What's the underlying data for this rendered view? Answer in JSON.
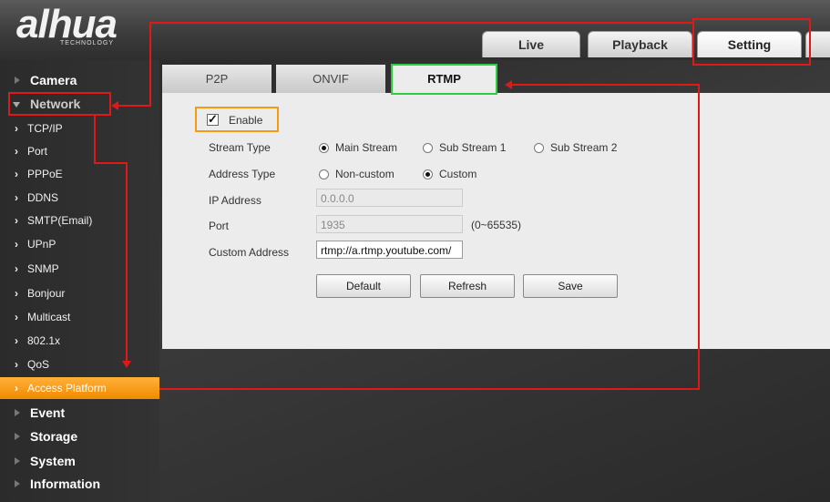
{
  "brand": {
    "name": "alhua",
    "tagline": "TECHNOLOGY"
  },
  "top_tabs": [
    "Live",
    "Playback",
    "Setting"
  ],
  "sidebar": {
    "camera": "Camera",
    "network": "Network",
    "network_items": [
      "TCP/IP",
      "Port",
      "PPPoE",
      "DDNS",
      "SMTP(Email)",
      "UPnP",
      "SNMP",
      "Bonjour",
      "Multicast",
      "802.1x",
      "QoS",
      "Access Platform"
    ],
    "event": "Event",
    "storage": "Storage",
    "system": "System",
    "information": "Information"
  },
  "sub_tabs": [
    "P2P",
    "ONVIF",
    "RTMP"
  ],
  "form": {
    "enable_label": "Enable",
    "enable_checked": true,
    "stream_type_label": "Stream Type",
    "stream_options": [
      "Main Stream",
      "Sub Stream 1",
      "Sub Stream 2"
    ],
    "stream_selected": "Main Stream",
    "address_type_label": "Address Type",
    "address_options": [
      "Non-custom",
      "Custom"
    ],
    "address_selected": "Custom",
    "ip_label": "IP Address",
    "ip_value": "0.0.0.0",
    "port_label": "Port",
    "port_value": "1935",
    "port_range": "(0~65535)",
    "custom_address_label": "Custom Address",
    "custom_address_value": "rtmp://a.rtmp.youtube.com/"
  },
  "buttons": {
    "default": "Default",
    "refresh": "Refresh",
    "save": "Save"
  },
  "colors": {
    "highlight_orange": "#f28c00",
    "annotation_red": "#e01818",
    "annotation_green": "#2ecc40",
    "annotation_orange": "#f39c12"
  }
}
